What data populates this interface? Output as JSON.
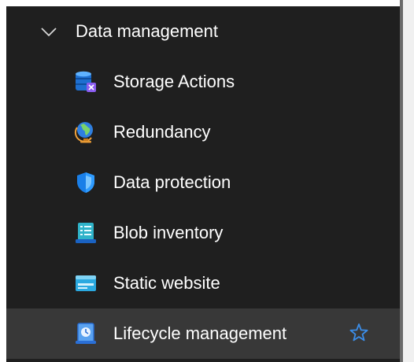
{
  "group": {
    "label": "Data management",
    "expanded": true,
    "chevron_icon": "chevron-down-icon"
  },
  "items": [
    {
      "label": "Storage Actions",
      "icon": "storage-actions-icon"
    },
    {
      "label": "Redundancy",
      "icon": "globe-icon"
    },
    {
      "label": "Data protection",
      "icon": "shield-icon"
    },
    {
      "label": "Blob inventory",
      "icon": "blob-inventory-icon"
    },
    {
      "label": "Static website",
      "icon": "static-website-icon"
    },
    {
      "label": "Lifecycle management",
      "icon": "lifecycle-management-icon",
      "selected": true,
      "favorite_icon": "star-icon"
    }
  ],
  "colors": {
    "panel_background": "#1f1f1f",
    "selected_background": "#383838",
    "text": "#ffffff",
    "accent": "#3b8de8"
  }
}
